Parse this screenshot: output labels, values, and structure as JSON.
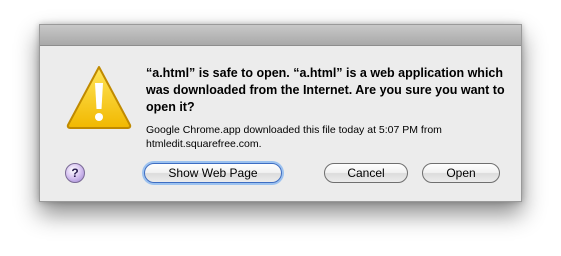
{
  "dialog": {
    "message": "“a.html” is safe to open. “a.html” is a web application which was downloaded from the Internet. Are you sure you want to open it?",
    "detail": "Google Chrome.app downloaded this file today at 5:07 PM from htmledit.squarefree.com.",
    "help_label": "?",
    "buttons": {
      "show_web_page": "Show Web Page",
      "cancel": "Cancel",
      "open": "Open"
    },
    "colors": {
      "warning_fill": "#f7c600",
      "warning_border": "#c08a00",
      "default_button_glow": "#9cc2f0"
    },
    "icon": "warning-triangle-icon"
  }
}
